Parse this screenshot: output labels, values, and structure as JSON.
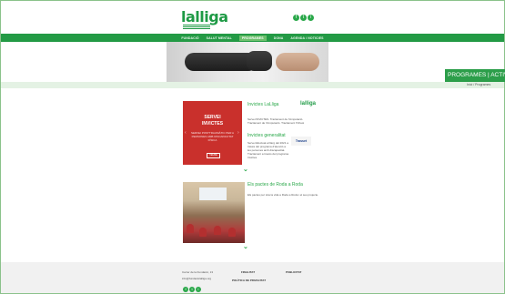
{
  "header": {
    "logo_text": "lalliga",
    "social": [
      "f",
      "t",
      "i"
    ]
  },
  "nav": {
    "items": [
      "FUNDACIÓ",
      "SALUT MENTAL",
      "PROGRAMES",
      "DONA",
      "AGENDA / NOTICIES"
    ]
  },
  "programs_banner": {
    "title": "PROGRAMES | ACTIVITA",
    "subtitle": "Inici / Programes"
  },
  "section1": {
    "card_title_1": "SERVEI",
    "card_title_2": "INVICTES",
    "card_text": "SERVEI POSTTRAUMÀTIC PER A PERSONES AMB DISCAPACITAT FÍSICA",
    "card_button": "VEURE",
    "title": "Invictes LaLliga",
    "text": "Servei INVICTES. Tractament de l'Amputació. Tractament de l'Amputació. Tractament l'Ortesi",
    "subtitle": "Invictes generalitat",
    "subtext": "Servei Efectuat al llarg del 2021 a través del programa d'atenció a les persones amb discapacitat. Tractament a través del programa Invictes.",
    "logo_mini": "lalliga",
    "sponsor": "Trasset"
  },
  "section2": {
    "title": "Els pactes de Roda a Roda",
    "text": "Els pactes per tota la vida a Roda a Roda i el seu projecte."
  },
  "footer": {
    "address": "Carrer de la Fundació, 13",
    "email": "info@fundaciolalliga.org",
    "col1": "FINALITAT",
    "col2": "PUBLICITAT",
    "col3": "POLÍTICA DE PRIVACITAT",
    "social": [
      "f",
      "t",
      "i"
    ]
  },
  "colors": {
    "brand_green": "#239a45",
    "card_red": "#c9302c"
  }
}
